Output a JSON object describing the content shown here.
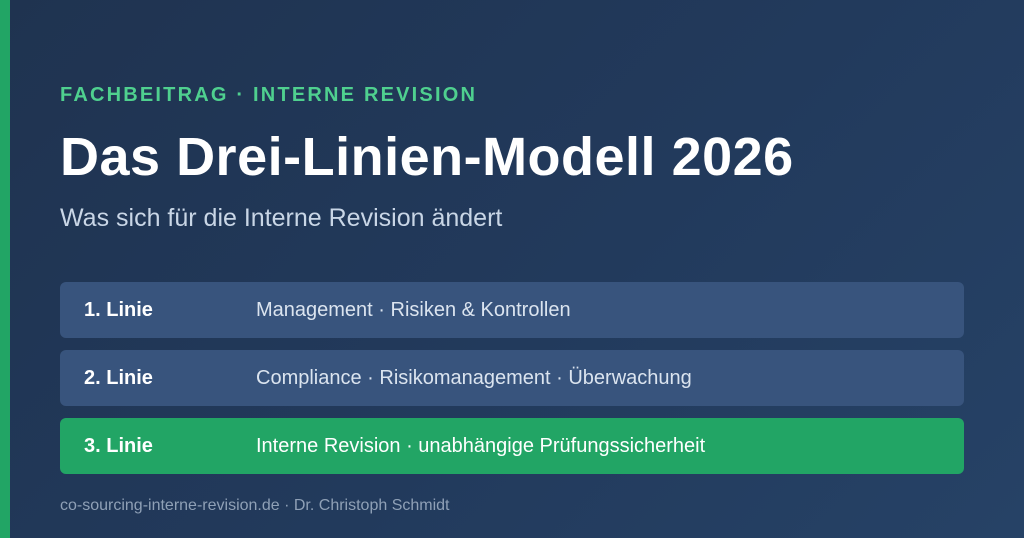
{
  "header": {
    "eyebrow": "FACHBEITRAG · INTERNE REVISION",
    "title": "Das Drei-Linien-Modell 2026",
    "subtitle": "Was sich für die Interne Revision ändert"
  },
  "lines": [
    {
      "label": "1. Linie",
      "description": "Management · Risiken & Kontrollen",
      "highlighted": false
    },
    {
      "label": "2. Linie",
      "description": "Compliance · Risikomanagement · Überwachung",
      "highlighted": false
    },
    {
      "label": "3. Linie",
      "description": "Interne Revision · unabhängige Prüfungssicherheit",
      "highlighted": true
    }
  ],
  "footer": {
    "text": "co-sourcing-interne-revision.de · Dr. Christoph Schmidt"
  },
  "colors": {
    "background": "#223a5c",
    "accent": "#22a565",
    "eyebrow": "#4fd08f",
    "row": "#38547d"
  }
}
